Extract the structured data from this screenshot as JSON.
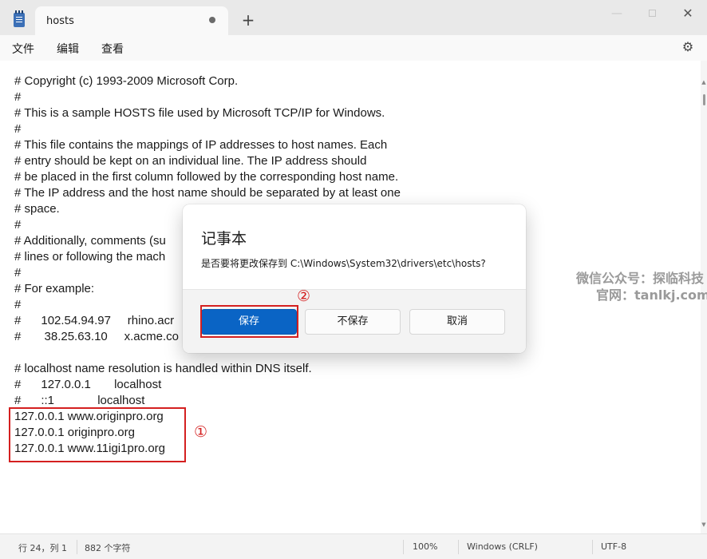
{
  "titlebar": {
    "tab_title": "hosts",
    "new_tab": "+",
    "minimize": "—",
    "close": "✕"
  },
  "menu": {
    "items": [
      "文件",
      "编辑",
      "查看"
    ],
    "settings_icon": "gear-icon"
  },
  "editor": {
    "lines": [
      "# Copyright (c) 1993-2009 Microsoft Corp.",
      "#",
      "# This is a sample HOSTS file used by Microsoft TCP/IP for Windows.",
      "#",
      "# This file contains the mappings of IP addresses to host names. Each",
      "# entry should be kept on an individual line. The IP address should",
      "# be placed in the first column followed by the corresponding host name.",
      "# The IP address and the host name should be separated by at least one",
      "# space.",
      "#",
      "# Additionally, comments (su",
      "# lines or following the mach",
      "#",
      "# For example:",
      "#",
      "#      102.54.94.97     rhino.acr",
      "#       38.25.63.10     x.acme.co",
      "",
      "# localhost name resolution is handled within DNS itself.",
      "#      127.0.0.1       localhost",
      "#      ::1             localhost",
      "127.0.0.1 www.originpro.org",
      "127.0.0.1 originpro.org",
      "127.0.0.1 www.11igi1pro.org"
    ]
  },
  "annotations": {
    "circle_1": "①",
    "circle_2": "②"
  },
  "watermark": {
    "line1": "微信公众号：探临科技",
    "line2": "官网：tanlkj.com"
  },
  "dialog": {
    "title": "记事本",
    "message": "是否要将更改保存到 C:\\Windows\\System32\\drivers\\etc\\hosts?",
    "save_label": "保存",
    "dont_save_label": "不保存",
    "cancel_label": "取消"
  },
  "status": {
    "position": "行 24，列 1",
    "char_count": "882 个字符",
    "zoom": "100%",
    "line_ending": "Windows (CRLF)",
    "encoding": "UTF-8"
  },
  "colors": {
    "accent": "#0a64c5",
    "annotation_red": "#d42020"
  }
}
